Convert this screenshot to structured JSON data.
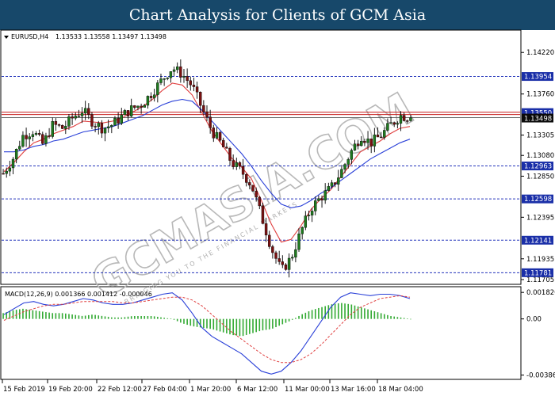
{
  "banner": {
    "title": "Chart Analysis for Clients of GCM Asia"
  },
  "header": {
    "symbol": "EURUSD,H4",
    "ohlc": "1.13533 1.13558 1.13497 1.13498",
    "macd_label": "MACD(12,26,9) 0.001366 0.001412 -0.000046"
  },
  "watermark": {
    "text": "GCMASIA.COM",
    "sub": "BRINGING YOU TO THE FINANCIAL MARKETS"
  },
  "colors": {
    "bull": "#1e7a1e",
    "bear": "#7a1010",
    "ma_fast": "#e04040",
    "ma_slow": "#2a40d8",
    "level_line": "#2233bb",
    "tag_bg": "#1a2fa8",
    "price_tag_bg": "#0a0a0a",
    "red_line": "#c82020",
    "histogram": "#33aa33",
    "macd_line": "#2a40d8",
    "signal_line": "#e04040"
  },
  "chart_data": {
    "type": "candlestick",
    "symbol": "EURUSD",
    "timeframe": "H4",
    "ylim": [
      1.1167,
      1.1445
    ],
    "y_ticks": [
      "1.14220",
      "1.13760",
      "1.13305",
      "1.13080",
      "1.12850",
      "1.12395",
      "1.11935",
      "1.11705"
    ],
    "x_labels": [
      "15 Feb 2019",
      "19 Feb 20:00",
      "22 Feb 12:00",
      "27 Feb 04:00",
      "1 Mar 20:00",
      "6 Mar 12:00",
      "11 Mar 00:00",
      "13 Mar 16:00",
      "18 Mar 04:00"
    ],
    "levels": [
      "1.13954",
      "1.12963",
      "1.12598",
      "1.12141",
      "1.11781"
    ],
    "current_price": "1.13498",
    "resistance_price": "1.13550",
    "series": [
      {
        "name": "price",
        "close_path": [
          1.1288,
          1.1305,
          1.133,
          1.1335,
          1.132,
          1.1342,
          1.1338,
          1.135,
          1.1358,
          1.1345,
          1.1338,
          1.1342,
          1.1352,
          1.136,
          1.1365,
          1.1378,
          1.1392,
          1.1405,
          1.1398,
          1.1385,
          1.136,
          1.1335,
          1.132,
          1.13,
          1.129,
          1.1275,
          1.124,
          1.1205,
          1.118,
          1.1195,
          1.1225,
          1.125,
          1.1262,
          1.1272,
          1.129,
          1.1312,
          1.133,
          1.1322,
          1.133,
          1.1342,
          1.1352,
          1.135
        ]
      },
      {
        "name": "ma_fast",
        "values": [
          1.129,
          1.13,
          1.1312,
          1.1322,
          1.1326,
          1.1332,
          1.1336,
          1.134,
          1.1346,
          1.1345,
          1.1344,
          1.1346,
          1.135,
          1.1356,
          1.1362,
          1.137,
          1.138,
          1.1388,
          1.1386,
          1.1375,
          1.1355,
          1.1335,
          1.132,
          1.1305,
          1.1295,
          1.1282,
          1.1258,
          1.1232,
          1.1212,
          1.1215,
          1.123,
          1.1248,
          1.126,
          1.127,
          1.1284,
          1.1298,
          1.1312,
          1.1318,
          1.1324,
          1.1332,
          1.1338,
          1.134
        ]
      },
      {
        "name": "ma_slow",
        "values": [
          1.1312,
          1.1312,
          1.1314,
          1.1318,
          1.132,
          1.1324,
          1.1326,
          1.133,
          1.1334,
          1.1336,
          1.1338,
          1.134,
          1.1344,
          1.1348,
          1.1352,
          1.1358,
          1.1364,
          1.1368,
          1.137,
          1.1368,
          1.1358,
          1.1346,
          1.1334,
          1.1322,
          1.131,
          1.1296,
          1.128,
          1.1266,
          1.1254,
          1.125,
          1.1252,
          1.1258,
          1.1266,
          1.1272,
          1.128,
          1.1288,
          1.1296,
          1.1304,
          1.131,
          1.1316,
          1.1322,
          1.1326
        ]
      }
    ],
    "macd": {
      "label": "MACD(12,26,9)",
      "ylim": [
        -0.004,
        0.002
      ],
      "y_ticks": [
        "0.001826",
        "0.00",
        "-0.003868"
      ],
      "histogram": [
        0.0004,
        0.0006,
        0.0007,
        0.0006,
        0.0005,
        0.0004,
        0.0004,
        0.0003,
        0.0002,
        0.0003,
        0.0002,
        0.0001,
        0.0001,
        0.0002,
        0.0002,
        0.0002,
        0.0001,
        0.0,
        -0.0003,
        -0.0005,
        -0.0006,
        -0.0007,
        -0.0009,
        -0.0011,
        -0.0012,
        -0.001,
        -0.0008,
        -0.0007,
        -0.0004,
        -0.0001,
        0.0003,
        0.0006,
        0.0008,
        0.001,
        0.0011,
        0.001,
        0.0008,
        0.0006,
        0.0004,
        0.0002,
        0.0001,
        0.0
      ],
      "macd_line": [
        0.0003,
        0.0007,
        0.0011,
        0.0012,
        0.001,
        0.0009,
        0.001,
        0.0012,
        0.0014,
        0.0013,
        0.0011,
        0.001,
        0.001,
        0.0011,
        0.0013,
        0.0015,
        0.0017,
        0.0018,
        0.0013,
        0.0004,
        -0.0006,
        -0.0012,
        -0.0016,
        -0.002,
        -0.0024,
        -0.003,
        -0.0036,
        -0.0038,
        -0.0036,
        -0.003,
        -0.0022,
        -0.0012,
        -0.0002,
        0.0008,
        0.0015,
        0.0018,
        0.0017,
        0.0016,
        0.0017,
        0.0017,
        0.0016,
        0.0014
      ],
      "signal_line": [
        -0.0001,
        0.0002,
        0.0005,
        0.0007,
        0.0009,
        0.001,
        0.001,
        0.0011,
        0.0012,
        0.0012,
        0.0012,
        0.0012,
        0.0011,
        0.0011,
        0.0012,
        0.0013,
        0.0014,
        0.0015,
        0.0015,
        0.0013,
        0.0009,
        0.0003,
        -0.0003,
        -0.0009,
        -0.0014,
        -0.0019,
        -0.0024,
        -0.0028,
        -0.003,
        -0.003,
        -0.0028,
        -0.0024,
        -0.0018,
        -0.0011,
        -0.0004,
        0.0003,
        0.0008,
        0.0011,
        0.0014,
        0.0015,
        0.0016,
        0.0015
      ]
    }
  }
}
